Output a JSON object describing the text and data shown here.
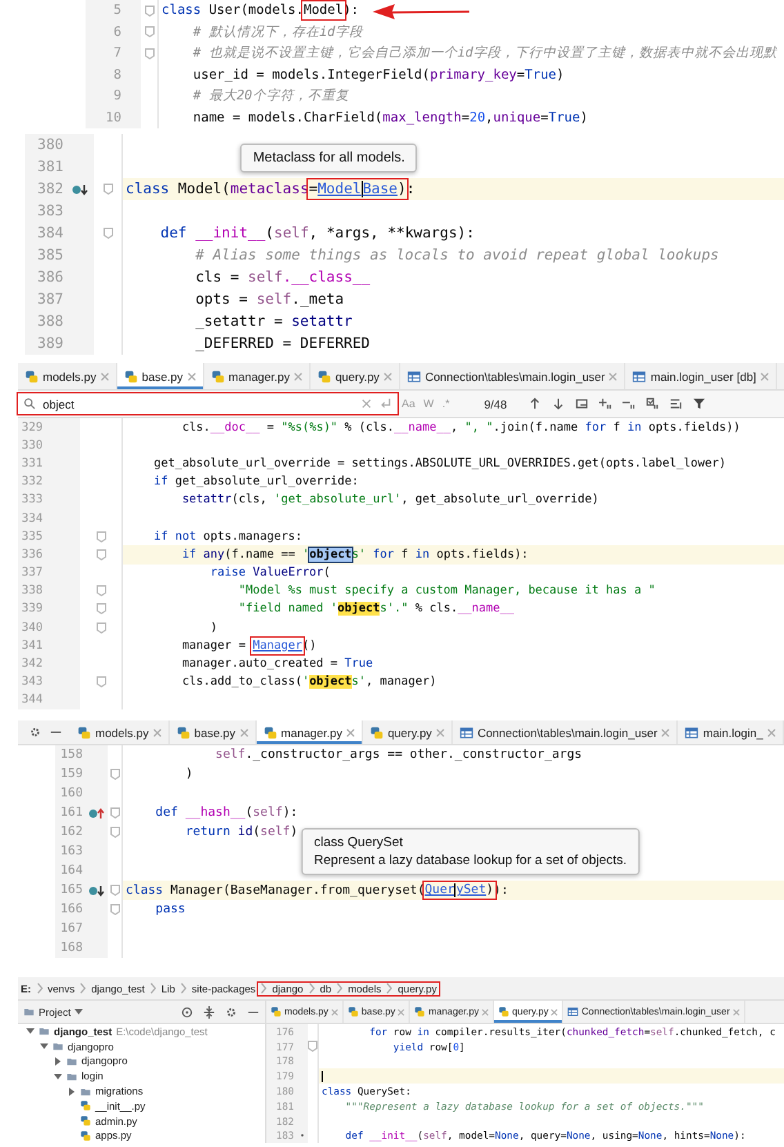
{
  "panels": [
    {
      "lines": [
        {
          "number": "5",
          "fold": true,
          "arrow": true,
          "segments": [
            {
              "kind": "keyword",
              "text": "class"
            },
            {
              "kind": "plain",
              "text": " User(models."
            },
            {
              "kind": "plain",
              "text": "Model",
              "boxed": true
            },
            {
              "kind": "plain",
              "text": "):"
            }
          ]
        },
        {
          "number": "6",
          "fold": true,
          "segments": [
            {
              "kind": "comment",
              "text": "    # 默认情况下，存在id字段"
            }
          ]
        },
        {
          "number": "7",
          "fold": true,
          "segments": [
            {
              "kind": "comment",
              "text": "    # 也就是说不设置主键，它会自己添加一个id字段，下行中设置了主键，数据表中就不会出现默"
            }
          ]
        },
        {
          "number": "8",
          "segments": [
            {
              "kind": "plain",
              "text": "    user_id = models.IntegerField("
            },
            {
              "kind": "param",
              "text": "primary_key"
            },
            {
              "kind": "plain",
              "text": "="
            },
            {
              "kind": "keyword",
              "text": "True"
            },
            {
              "kind": "plain",
              "text": ")"
            }
          ]
        },
        {
          "number": "9",
          "segments": [
            {
              "kind": "comment",
              "text": "    # 最大20个字符，不重复"
            }
          ]
        },
        {
          "number": "10",
          "segments": [
            {
              "kind": "plain",
              "text": "    name = models.CharField("
            },
            {
              "kind": "param",
              "text": "max_length"
            },
            {
              "kind": "plain",
              "text": "="
            },
            {
              "kind": "number",
              "text": "20"
            },
            {
              "kind": "plain",
              "text": ","
            },
            {
              "kind": "param",
              "text": "unique"
            },
            {
              "kind": "plain",
              "text": "="
            },
            {
              "kind": "keyword",
              "text": "True"
            },
            {
              "kind": "plain",
              "text": ")"
            }
          ]
        }
      ]
    },
    {
      "lines": [
        {
          "number": "380"
        },
        {
          "number": "381"
        },
        {
          "number": "382",
          "current": true,
          "marker": {
            "kind": "override_down"
          },
          "fold": true,
          "segments": [
            {
              "kind": "keyword",
              "text": "class"
            },
            {
              "kind": "plain",
              "text": " Model("
            },
            {
              "kind": "param",
              "text": "metaclass"
            },
            {
              "kind": "plain",
              "text": "=",
              "boxed": true,
              "tooltip": [
                "Metaclass for all models."
              ]
            },
            {
              "kind": "link",
              "text": "Model",
              "boxed": true
            },
            {
              "kind": "caret",
              "boxed": true
            },
            {
              "kind": "link",
              "text": "Base",
              "boxed": true
            },
            {
              "kind": "plain",
              "text": ")",
              "boxed": true
            },
            {
              "kind": "plain",
              "text": ":"
            }
          ]
        },
        {
          "number": "383"
        },
        {
          "number": "384",
          "fold": true,
          "segments": [
            {
              "kind": "keyword",
              "text": "    def"
            },
            {
              "kind": "dunder",
              "text": " __init__"
            },
            {
              "kind": "plain",
              "text": "("
            },
            {
              "kind": "self",
              "text": "self"
            },
            {
              "kind": "plain",
              "text": ", *args, **kwargs):"
            }
          ]
        },
        {
          "number": "385",
          "segments": [
            {
              "kind": "comment",
              "text": "        # Alias some things as locals to avoid repeat global lookups"
            }
          ]
        },
        {
          "number": "386",
          "segments": [
            {
              "kind": "plain",
              "text": "        cls = "
            },
            {
              "kind": "self",
              "text": "self"
            },
            {
              "kind": "dunder",
              "text": ".__class__"
            }
          ]
        },
        {
          "number": "387",
          "segments": [
            {
              "kind": "plain",
              "text": "        opts = "
            },
            {
              "kind": "self",
              "text": "self"
            },
            {
              "kind": "plain",
              "text": "._meta"
            }
          ]
        },
        {
          "number": "388",
          "segments": [
            {
              "kind": "plain",
              "text": "        _setattr = "
            },
            {
              "kind": "builtin",
              "text": "setattr"
            }
          ]
        },
        {
          "number": "389",
          "segments": [
            {
              "kind": "plain",
              "text": "        _DEFERRED = DEFERRED"
            }
          ]
        }
      ]
    },
    {
      "tabs": [
        {
          "label": "models.py",
          "kind": "python",
          "selected": false
        },
        {
          "label": "base.py",
          "kind": "python",
          "selected": true
        },
        {
          "label": "manager.py",
          "kind": "python",
          "selected": false
        },
        {
          "label": "query.py",
          "kind": "python",
          "selected": false
        },
        {
          "label": "Connection\\tables\\main.login_user",
          "kind": "table",
          "selected": false
        },
        {
          "label": "main.login_user [db]",
          "kind": "table",
          "selected": false
        }
      ],
      "search": {
        "value": "object",
        "boxed": true,
        "options": [
          "Aa",
          "W",
          ".*"
        ],
        "match_count": "9/48"
      },
      "lines": [
        {
          "number": "329",
          "segments": [
            {
              "kind": "plain",
              "text": "        cls."
            },
            {
              "kind": "dunder",
              "text": "__doc__"
            },
            {
              "kind": "plain",
              "text": " = "
            },
            {
              "kind": "string",
              "text": "\"%s(%s)\""
            },
            {
              "kind": "plain",
              "text": " % (cls."
            },
            {
              "kind": "dunder",
              "text": "__name__"
            },
            {
              "kind": "plain",
              "text": ", "
            },
            {
              "kind": "string",
              "text": "\", \""
            },
            {
              "kind": "plain",
              "text": ".join(f.name "
            },
            {
              "kind": "keyword",
              "text": "for"
            },
            {
              "kind": "plain",
              "text": " f "
            },
            {
              "kind": "keyword",
              "text": "in"
            },
            {
              "kind": "plain",
              "text": " opts.fields))"
            }
          ]
        },
        {
          "number": "330"
        },
        {
          "number": "331",
          "segments": [
            {
              "kind": "plain",
              "text": "    get_absolute_url_override = settings.ABSOLUTE_URL_OVERRIDES.get(opts.label_lower)"
            }
          ]
        },
        {
          "number": "332",
          "segments": [
            {
              "kind": "keyword",
              "text": "    if"
            },
            {
              "kind": "plain",
              "text": " get_absolute_url_override:"
            }
          ]
        },
        {
          "number": "333",
          "segments": [
            {
              "kind": "builtin",
              "text": "        setattr"
            },
            {
              "kind": "plain",
              "text": "(cls, "
            },
            {
              "kind": "string",
              "text": "'get_absolute_url'"
            },
            {
              "kind": "plain",
              "text": ", get_absolute_url_override)"
            }
          ]
        },
        {
          "number": "334"
        },
        {
          "number": "335",
          "fold": true,
          "segments": [
            {
              "kind": "keyword",
              "text": "    if not"
            },
            {
              "kind": "plain",
              "text": " opts.managers:"
            }
          ]
        },
        {
          "number": "336",
          "current": true,
          "fold": true,
          "segments": [
            {
              "kind": "keyword",
              "text": "        if"
            },
            {
              "kind": "builtin",
              "text": " any"
            },
            {
              "kind": "plain",
              "text": "(f.name == "
            },
            {
              "kind": "string",
              "text": "'"
            },
            {
              "kind": "match_current",
              "text": "object"
            },
            {
              "kind": "string",
              "text": "s'"
            },
            {
              "kind": "keyword",
              "text": " for"
            },
            {
              "kind": "plain",
              "text": " f "
            },
            {
              "kind": "keyword",
              "text": "in"
            },
            {
              "kind": "plain",
              "text": " opts.fields):"
            }
          ]
        },
        {
          "number": "337",
          "segments": [
            {
              "kind": "keyword",
              "text": "            raise"
            },
            {
              "kind": "builtin",
              "text": " ValueError"
            },
            {
              "kind": "plain",
              "text": "("
            }
          ]
        },
        {
          "number": "338",
          "fold": true,
          "segments": [
            {
              "kind": "string",
              "text": "                \"Model %s must specify a custom Manager, because it has a \""
            }
          ]
        },
        {
          "number": "339",
          "fold": true,
          "segments": [
            {
              "kind": "string",
              "text": "                \"field named '"
            },
            {
              "kind": "match",
              "text": "object"
            },
            {
              "kind": "string",
              "text": "s'.\""
            },
            {
              "kind": "plain",
              "text": " % cls."
            },
            {
              "kind": "dunder",
              "text": "__name__"
            }
          ]
        },
        {
          "number": "340",
          "fold": true,
          "segments": [
            {
              "kind": "plain",
              "text": "            )"
            }
          ]
        },
        {
          "number": "341",
          "segments": [
            {
              "kind": "plain",
              "text": "        manager = "
            },
            {
              "kind": "link",
              "text": "Manager",
              "boxed": true
            },
            {
              "kind": "plain",
              "text": "()"
            }
          ]
        },
        {
          "number": "342",
          "segments": [
            {
              "kind": "plain",
              "text": "        manager.auto_created = "
            },
            {
              "kind": "keyword",
              "text": "True"
            }
          ]
        },
        {
          "number": "343",
          "fold": true,
          "segments": [
            {
              "kind": "plain",
              "text": "        cls.add_to_class("
            },
            {
              "kind": "string",
              "text": "'"
            },
            {
              "kind": "match",
              "text": "object"
            },
            {
              "kind": "string",
              "text": "s'"
            },
            {
              "kind": "plain",
              "text": ", manager)"
            }
          ]
        },
        {
          "number": "344"
        }
      ]
    },
    {
      "tool_strip": true,
      "tabs": [
        {
          "label": "models.py",
          "kind": "python",
          "selected": false
        },
        {
          "label": "base.py",
          "kind": "python",
          "selected": false
        },
        {
          "label": "manager.py",
          "kind": "python",
          "selected": true
        },
        {
          "label": "query.py",
          "kind": "python",
          "selected": false
        },
        {
          "label": "Connection\\tables\\main.login_user",
          "kind": "table",
          "selected": false
        },
        {
          "label": "main.login_",
          "kind": "table",
          "selected": false
        }
      ],
      "lines": [
        {
          "number": "158",
          "segments": [
            {
              "kind": "self",
              "text": "            self"
            },
            {
              "kind": "plain",
              "text": "._constructor_args == other._constructor_args"
            }
          ]
        },
        {
          "number": "159",
          "fold": true,
          "segments": [
            {
              "kind": "plain",
              "text": "        )"
            }
          ]
        },
        {
          "number": "160"
        },
        {
          "number": "161",
          "marker": {
            "kind": "override_up"
          },
          "fold": true,
          "segments": [
            {
              "kind": "keyword",
              "text": "    def"
            },
            {
              "kind": "dunder",
              "text": " __hash__"
            },
            {
              "kind": "plain",
              "text": "("
            },
            {
              "kind": "self",
              "text": "self"
            },
            {
              "kind": "plain",
              "text": "):"
            }
          ]
        },
        {
          "number": "162",
          "fold": true,
          "segments": [
            {
              "kind": "keyword",
              "text": "        return"
            },
            {
              "kind": "builtin",
              "text": " id"
            },
            {
              "kind": "plain",
              "text": "("
            },
            {
              "kind": "self",
              "text": "self"
            },
            {
              "kind": "plain",
              "text": ")"
            }
          ]
        },
        {
          "number": "163"
        },
        {
          "number": "164"
        },
        {
          "number": "165",
          "current": true,
          "marker": {
            "kind": "override_down"
          },
          "fold": true,
          "segments": [
            {
              "kind": "keyword",
              "text": "class"
            },
            {
              "kind": "plain",
              "text": " Manager(BaseManager.from_queryset("
            },
            {
              "kind": "link",
              "text": "Quer",
              "boxed": true,
              "tooltip": [
                "class QuerySet",
                "Represent a lazy database lookup for a set of objects."
              ]
            },
            {
              "kind": "caret",
              "boxed": true
            },
            {
              "kind": "link",
              "text": "ySet",
              "boxed": true
            },
            {
              "kind": "plain",
              "text": ")",
              "boxed": true
            },
            {
              "kind": "plain",
              "text": "):"
            }
          ]
        },
        {
          "number": "166",
          "fold": true,
          "segments": [
            {
              "kind": "keyword",
              "text": "    pass"
            }
          ]
        },
        {
          "number": "167"
        },
        {
          "number": "168"
        }
      ]
    },
    {
      "breadcrumb": [
        {
          "label": "E:",
          "boxed": false
        },
        {
          "label": "venvs",
          "boxed": false
        },
        {
          "label": "django_test",
          "boxed": false
        },
        {
          "label": "Lib",
          "boxed": false
        },
        {
          "label": "site-packages",
          "boxed": false
        },
        {
          "label": "django",
          "boxed": true
        },
        {
          "label": "db",
          "boxed": true
        },
        {
          "label": "models",
          "boxed": true
        },
        {
          "label": "query.py",
          "boxed": true
        }
      ],
      "project": {
        "title": "Project",
        "items": [
          {
            "label": "django_test",
            "note": "E:\\code\\django_test",
            "kind": "project",
            "expanded": true,
            "children": [
              {
                "label": "djangopro",
                "kind": "folder",
                "expanded": true,
                "children": [
                  {
                    "label": "djangopro",
                    "kind": "folder",
                    "expanded": false
                  },
                  {
                    "label": "login",
                    "kind": "folder",
                    "expanded": true,
                    "children": [
                      {
                        "label": "migrations",
                        "kind": "folder",
                        "expanded": false
                      },
                      {
                        "label": "__init__.py",
                        "kind": "python"
                      },
                      {
                        "label": "admin.py",
                        "kind": "python"
                      },
                      {
                        "label": "apps.py",
                        "kind": "python"
                      }
                    ]
                  }
                ]
              }
            ]
          }
        ]
      },
      "tabs": [
        {
          "label": "models.py",
          "kind": "python",
          "selected": false
        },
        {
          "label": "base.py",
          "kind": "python",
          "selected": false
        },
        {
          "label": "manager.py",
          "kind": "python",
          "selected": false
        },
        {
          "label": "query.py",
          "kind": "python",
          "selected": true
        },
        {
          "label": "Connection\\tables\\main.login_user",
          "kind": "table",
          "selected": false
        }
      ],
      "lines": [
        {
          "number": "176",
          "segments": [
            {
              "kind": "keyword",
              "text": "        for"
            },
            {
              "kind": "plain",
              "text": " row "
            },
            {
              "kind": "keyword",
              "text": "in"
            },
            {
              "kind": "plain",
              "text": " compiler.results_iter("
            },
            {
              "kind": "param",
              "text": "chunked_fetch"
            },
            {
              "kind": "plain",
              "text": "="
            },
            {
              "kind": "self",
              "text": "self"
            },
            {
              "kind": "plain",
              "text": ".chunked_fetch, c"
            }
          ]
        },
        {
          "number": "177",
          "fold": true,
          "segments": [
            {
              "kind": "keyword",
              "text": "            yield"
            },
            {
              "kind": "plain",
              "text": " row["
            },
            {
              "kind": "number",
              "text": "0"
            },
            {
              "kind": "plain",
              "text": "]"
            }
          ]
        },
        {
          "number": "178"
        },
        {
          "number": "179",
          "current": true,
          "segments": [
            {
              "kind": "caret"
            }
          ]
        },
        {
          "number": "180",
          "segments": [
            {
              "kind": "keyword",
              "text": "class"
            },
            {
              "kind": "plain",
              "text": " QuerySet:"
            }
          ]
        },
        {
          "number": "181",
          "segments": [
            {
              "kind": "docstring",
              "text": "    \"\"\"Represent a lazy database lookup for a set of objects.\"\"\""
            }
          ]
        },
        {
          "number": "182"
        },
        {
          "number": "183",
          "marker": {
            "kind": "dot"
          },
          "segments": [
            {
              "kind": "keyword",
              "text": "    def"
            },
            {
              "kind": "dunder",
              "text": " __init__"
            },
            {
              "kind": "plain",
              "text": "("
            },
            {
              "kind": "self",
              "text": "self"
            },
            {
              "kind": "plain",
              "text": ", model="
            },
            {
              "kind": "keyword",
              "text": "None"
            },
            {
              "kind": "plain",
              "text": ", query="
            },
            {
              "kind": "keyword",
              "text": "None"
            },
            {
              "kind": "plain",
              "text": ", using="
            },
            {
              "kind": "keyword",
              "text": "None"
            },
            {
              "kind": "plain",
              "text": ", hints="
            },
            {
              "kind": "keyword",
              "text": "None"
            },
            {
              "kind": "plain",
              "text": "):"
            }
          ]
        }
      ]
    }
  ]
}
